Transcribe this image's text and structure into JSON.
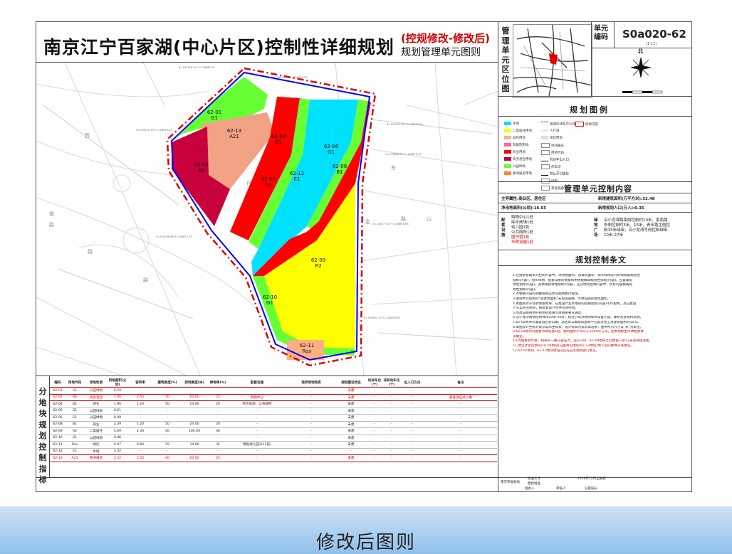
{
  "title": "南京江宁百家湖(中心片区)控制性详细规划",
  "subtitle_red": "(控规修改-修改后)",
  "subtitle": "规划管理单元图则",
  "caption": "修改后图则",
  "location_label": [
    "管",
    "理",
    "单",
    "元",
    "区",
    "位",
    "图"
  ],
  "unit": {
    "label": "单元编码",
    "code": "S0a020-62",
    "sheet": "(1-12)"
  },
  "compass_label": "北",
  "legend_title": "规划图例",
  "legend_items": [
    "水域",
    "二类居住用地",
    "幼托用地",
    "影剧院用地",
    "商业用地",
    "商务混合用地",
    "公园绿地",
    "图书展览用地",
    "国道红线及中心线",
    "人行道",
    "现状用地",
    "地块编号",
    "用地代码",
    "机动车出入口",
    "停车场",
    "禁止开口路段",
    "绿带",
    "景观视廊",
    "修改内容"
  ],
  "legend_colors": {
    "water": "#00e0ff",
    "residential": "#ffff00",
    "kindergarten": "#ffb080",
    "cinema": "#ff60a0",
    "commercial": "#ff0000",
    "mixed": "#c8003c",
    "park": "#66ff33",
    "library": "#ff8040"
  },
  "control_title": "管理单元控制内容",
  "control": {
    "attr_label": "主导属性:商业区、居住区",
    "area_label": "新增建筑面积(万平方米):32.48",
    "net_label": "净用地面积(公顷):16.55",
    "pop_label": "新增规划人口(万人):0.35"
  },
  "facilities_label": "配套设施",
  "facilities": [
    "购物中心1处",
    "综合商场1处",
    "幼儿园1处",
    "公共厕所1处",
    "图书馆1处",
    "市政设施1处"
  ],
  "green_label": "绿地广场",
  "green_text": [
    "沿小龙湾路南侧控制约10米，南南路",
    "东侧控制约5米、15米，青年路主侧控",
    "制15米绿带，沿小龙湾号侧控制绿带",
    "10米-27米"
  ],
  "clauses_title": "规划控制条文",
  "clauses": [
    {
      "text": "1.在规划管理单元控制内容中，净用地面积、总建筑面积、街头绿地以外的绿地属规划性",
      "red": false
    },
    {
      "text": "指标(内容)；街头绿地、配套设施的数量和用地规模属规划性指标(内容)，位置属指",
      "red": false
    },
    {
      "text": "导性指标(内容)，其余属指导性指标(内容)。在分地块控制内容中，所有内容都属指",
      "red": false
    },
    {
      "text": "导性指标(内容)。",
      "red": false
    },
    {
      "text": "2.对相关内容的调整规则应参见图则执行规定。",
      "red": false
    },
    {
      "text": "3.图则中元控制的\"总建筑面积\"未包括道路、市政设施的建筑面积。",
      "red": false
    },
    {
      "text": "4.本图则对于现状保留地块、已批设计案点地块的控制指标(内容)不作控制，对已批设",
      "red": false
    },
    {
      "text": "计方案点的地块，按批复设计条件有效控制。",
      "red": false
    },
    {
      "text": "5.市政设施用地的控制指标由市政相关要求确定。",
      "red": false
    },
    {
      "text": "6.沿小龙湾两侧控制绿带10米-20米，结合小龙湾两侧绿带设置小品、廊桥及景观构筑物。",
      "red": false
    },
    {
      "text": "7.62-02地块可兼容酒店式公寓，酒店式公寓建筑面积不应超过地上总建筑面积的35%。",
      "red": false
    },
    {
      "text": "8.本图设计坐标为南京城市坐标系，设计标高为吴淞高程系；图中所示尺寸以\"米\"为单位。",
      "red": false
    },
    {
      "text": "9.62-02地块内配套市政设施1处，建筑面积不得小于2500平方米，控制指标由市政相关要",
      "red": true
    },
    {
      "text": "求确定。",
      "red": true
    },
    {
      "text": "10.为缓解青年路、将来秆一路交通压力，在62-08、62-09地块之间预留一条12米宽辟住道路。",
      "red": true
    },
    {
      "text": "11.建议文化馆地块(10-04地块)与图书馆地块(62-13地块)地下空间整体开发建设。",
      "red": true
    },
    {
      "text": "12.62-02地块、62-13地块建设前应先征求规划部门意见。",
      "red": true
    }
  ],
  "stamp": {
    "org": "南京市规划局",
    "approve_label": "批准文件",
    "update_label": "更新批准",
    "approve_value": "2016年12月上报稿",
    "handler": "经办人",
    "checker": "审核人",
    "reviewer": "分管局长"
  },
  "table": {
    "side": [
      "分",
      "地",
      "块",
      "规",
      "划",
      "控",
      "制",
      "指",
      "标"
    ],
    "headers": [
      "编码",
      "用地代码",
      "用地性质",
      "用地面积(公顷)",
      "容积率",
      "建筑密度(%)",
      "控制高度(米)",
      "绿地率(%)",
      "配套设施",
      "现状用地性质",
      "规划建设状态",
      "机动车位(个)",
      "非机动车位(个)",
      "出入口方向",
      "备注"
    ],
    "rows": [
      {
        "c": [
          "62-01",
          "G1",
          "公园绿地",
          "0.29",
          "-",
          "-",
          "-",
          "-",
          "-",
          "-",
          "未建",
          "-",
          "-",
          "-",
          "-"
        ],
        "hl": true
      },
      {
        "c": [
          "62-02",
          "Bb",
          "商办混合",
          "1.46",
          "2.50",
          "50",
          "60.00",
          "25",
          "购物中心",
          "-",
          "未建",
          "-",
          "-",
          "-",
          "兼容酒店式公寓"
        ],
        "hl": true
      },
      {
        "c": [
          "62-04",
          "B1",
          "商业",
          "1.96",
          "1.20",
          "50",
          "24.00",
          "20",
          "综合商场、公共厕所",
          "-",
          "未建",
          "-",
          "-",
          "-",
          "-"
        ],
        "hl": false
      },
      {
        "c": [
          "62-05",
          "G1",
          "公园绿地",
          "0.61",
          "-",
          "-",
          "-",
          "-",
          "-",
          "-",
          "未建",
          "-",
          "-",
          "-",
          "-"
        ],
        "hl": false
      },
      {
        "c": [
          "62-06",
          "G1",
          "公园绿地",
          "0.99",
          "-",
          "-",
          "-",
          "-",
          "-",
          "-",
          "未建",
          "-",
          "-",
          "-",
          "-"
        ],
        "hl": false
      },
      {
        "c": [
          "62-08",
          "B1",
          "商业",
          "2.39",
          "1.20",
          "50",
          "24.00",
          "20",
          "-",
          "-",
          "未建",
          "-",
          "-",
          "-",
          "-"
        ],
        "hl": false
      },
      {
        "c": [
          "62-09",
          "R2",
          "二类居住",
          "5.69",
          "2.30",
          "20",
          "100.00",
          "30",
          "-",
          "-",
          "未建",
          "-",
          "-",
          "-",
          "-"
        ],
        "hl": false
      },
      {
        "c": [
          "62-10",
          "G1",
          "公园绿地",
          "0.46",
          "-",
          "-",
          "-",
          "-",
          "-",
          "-",
          "未建",
          "-",
          "-",
          "-",
          "-"
        ],
        "hl": false
      },
      {
        "c": [
          "62-11",
          "Rax",
          "幼托",
          "0.47",
          "0.80",
          "25",
          "24.00",
          "35",
          "杨振幼儿园1(12班)",
          "-",
          "未建",
          "-",
          "-",
          "-",
          "-"
        ],
        "hl": false
      },
      {
        "c": [
          "62-12",
          "E1",
          "水域",
          "3.32",
          "-",
          "-",
          "-",
          "-",
          "-",
          "-",
          "-",
          "-",
          "-",
          "-",
          "-"
        ],
        "hl": false
      },
      {
        "c": [
          "62-13",
          "A21",
          "图书展览",
          "2.22",
          "2.50",
          "40",
          "60.00",
          "25",
          "-",
          "-",
          "未建",
          "-",
          "-",
          "-",
          "-"
        ],
        "hl": true
      }
    ]
  },
  "map": {
    "parcels": [
      {
        "code": "62-01",
        "type": "G1"
      },
      {
        "code": "62-13",
        "type": "A21"
      },
      {
        "code": "62-02",
        "type": "Bb"
      },
      {
        "code": "62-04",
        "type": "B1"
      },
      {
        "code": "62-05",
        "type": "G1"
      },
      {
        "code": "62-12",
        "type": "E1"
      },
      {
        "code": "62-06",
        "type": "G1"
      },
      {
        "code": "62-08",
        "type": "B1"
      },
      {
        "code": "62-09",
        "type": "R2"
      },
      {
        "code": "62-10",
        "type": "G1"
      },
      {
        "code": "62-11",
        "type": "Rax"
      }
    ],
    "road_labels": [
      "西",
      "丹",
      "东",
      "山",
      "路",
      "路",
      "金",
      "路",
      "南",
      "路"
    ],
    "coords": [
      "X=135328.32 Y=128680.12",
      "X=135531.41 Y=128793.20",
      "X=135215.19 Y=128873.25",
      "X=133831.31 Y=128780.05",
      "X=133665.89 Y=128673.27",
      "X=134577.31 Y=128878.63",
      "X=133096.69 Y=128877.70",
      "X=134653.12 Y=128904.95",
      "X=133460.25 Y=128908.73"
    ]
  }
}
